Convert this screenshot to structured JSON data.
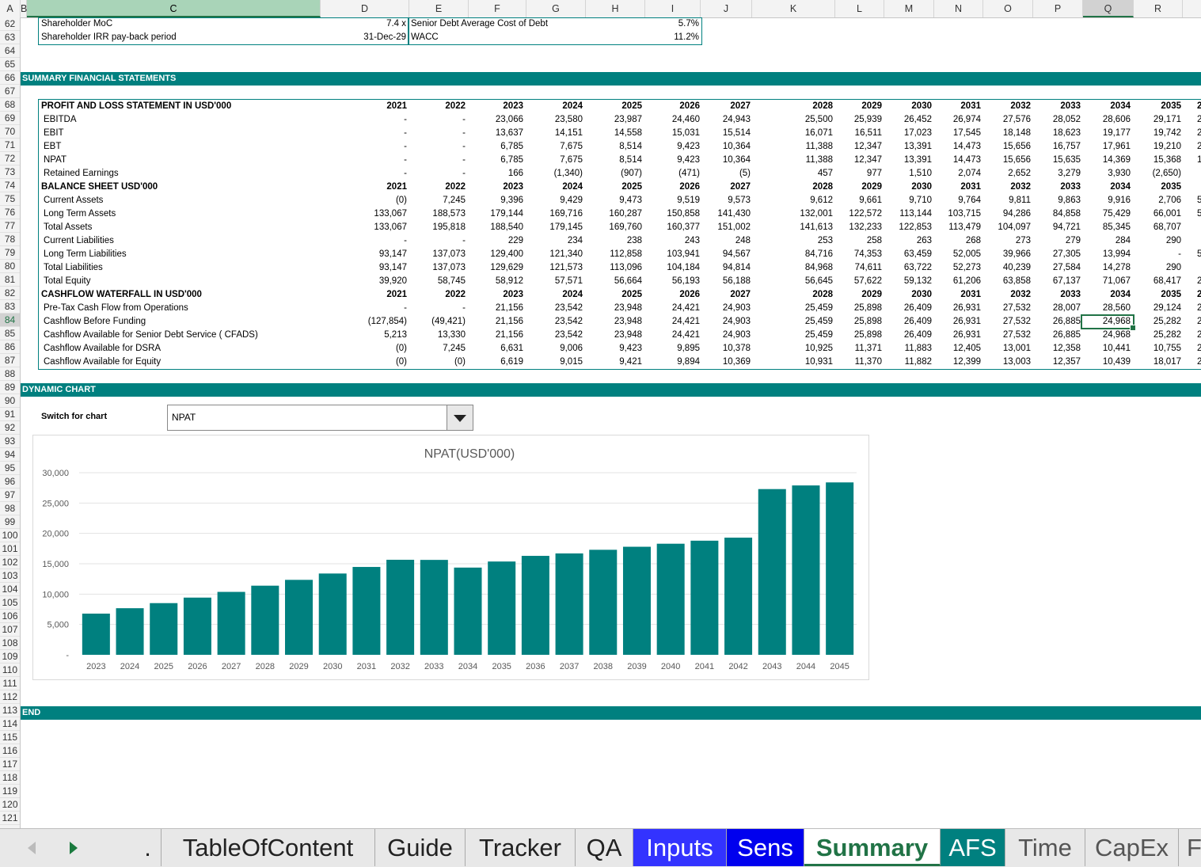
{
  "columns": [
    "A",
    "B",
    "C",
    "D",
    "E",
    "F",
    "G",
    "H",
    "I",
    "J",
    "K",
    "L",
    "M",
    "N",
    "O",
    "P",
    "Q",
    "R"
  ],
  "rows": [
    "62",
    "63",
    "64",
    "65",
    "66",
    "67",
    "68",
    "69",
    "70",
    "71",
    "72",
    "73",
    "74",
    "75",
    "76",
    "77",
    "78",
    "79",
    "80",
    "81",
    "82",
    "83",
    "84",
    "85",
    "86",
    "87",
    "88",
    "89",
    "90",
    "91",
    "92",
    "93",
    "94",
    "95",
    "96",
    "97",
    "98",
    "99",
    "100",
    "101",
    "102",
    "103",
    "104",
    "105",
    "106",
    "107",
    "108",
    "109",
    "110",
    "111",
    "112",
    "113",
    "114",
    "115",
    "116",
    "117",
    "118",
    "119",
    "120",
    "121"
  ],
  "top_metrics": {
    "moc_label": "Shareholder MoC",
    "moc_value": "7.4 x",
    "irr_label": "Shareholder IRR pay-back period",
    "irr_value": "31-Dec-29",
    "debt_label": "Senior Debt  Average Cost of Debt",
    "debt_value": "5.7%",
    "wacc_label": "WACC",
    "wacc_value": "11.2%"
  },
  "banners": {
    "summary": "SUMMARY FINANCIAL STATEMENTS",
    "dynamic": "DYNAMIC CHART",
    "end": "END"
  },
  "table": {
    "years": [
      "2021",
      "2022",
      "2023",
      "2024",
      "2025",
      "2026",
      "2027",
      "2028",
      "2029",
      "2030",
      "2031",
      "2032",
      "2033",
      "2034",
      "2035"
    ],
    "rows": [
      {
        "label": "PROFIT AND LOSS STATEMENT IN USD'000",
        "header": true
      },
      {
        "label": "EBITDA",
        "values": [
          "-",
          "-",
          "23,066",
          "23,580",
          "23,987",
          "24,460",
          "24,943",
          "25,500",
          "25,939",
          "26,452",
          "26,974",
          "27,576",
          "28,052",
          "28,606",
          "29,171"
        ]
      },
      {
        "label": "EBIT",
        "values": [
          "-",
          "-",
          "13,637",
          "14,151",
          "14,558",
          "15,031",
          "15,514",
          "16,071",
          "16,511",
          "17,023",
          "17,545",
          "18,148",
          "18,623",
          "19,177",
          "19,742"
        ]
      },
      {
        "label": "EBT",
        "values": [
          "-",
          "-",
          "6,785",
          "7,675",
          "8,514",
          "9,423",
          "10,364",
          "11,388",
          "12,347",
          "13,391",
          "14,473",
          "15,656",
          "16,757",
          "17,961",
          "19,210"
        ]
      },
      {
        "label": "NPAT",
        "values": [
          "-",
          "-",
          "6,785",
          "7,675",
          "8,514",
          "9,423",
          "10,364",
          "11,388",
          "12,347",
          "13,391",
          "14,473",
          "15,656",
          "15,635",
          "14,369",
          "15,368"
        ]
      },
      {
        "label": "Retained Earnings",
        "values": [
          "-",
          "-",
          "166",
          "(1,340)",
          "(907)",
          "(471)",
          "(5)",
          "457",
          "977",
          "1,510",
          "2,074",
          "2,652",
          "3,279",
          "3,930",
          "(2,650)"
        ]
      },
      {
        "label": "BALANCE SHEET USD'000",
        "header": true
      },
      {
        "label": "Current Assets",
        "values": [
          "(0)",
          "7,245",
          "9,396",
          "9,429",
          "9,473",
          "9,519",
          "9,573",
          "9,612",
          "9,661",
          "9,710",
          "9,764",
          "9,811",
          "9,863",
          "9,916",
          "2,706"
        ]
      },
      {
        "label": "Long Term Assets",
        "values": [
          "133,067",
          "188,573",
          "179,144",
          "169,716",
          "160,287",
          "150,858",
          "141,430",
          "132,001",
          "122,572",
          "113,144",
          "103,715",
          "94,286",
          "84,858",
          "75,429",
          "66,001"
        ]
      },
      {
        "label": "Total Assets",
        "values": [
          "133,067",
          "195,818",
          "188,540",
          "179,145",
          "169,760",
          "160,377",
          "151,002",
          "141,613",
          "132,233",
          "122,853",
          "113,479",
          "104,097",
          "94,721",
          "85,345",
          "68,707"
        ]
      },
      {
        "label": "Current Liabilities",
        "values": [
          "-",
          "-",
          "229",
          "234",
          "238",
          "243",
          "248",
          "253",
          "258",
          "263",
          "268",
          "273",
          "279",
          "284",
          "290"
        ]
      },
      {
        "label": "Long Term Liabilities",
        "values": [
          "93,147",
          "137,073",
          "129,400",
          "121,340",
          "112,858",
          "103,941",
          "94,567",
          "84,716",
          "74,353",
          "63,459",
          "52,005",
          "39,966",
          "27,305",
          "13,994",
          "-"
        ]
      },
      {
        "label": "Total Liabilities",
        "values": [
          "93,147",
          "137,073",
          "129,629",
          "121,573",
          "113,096",
          "104,184",
          "94,814",
          "84,968",
          "74,611",
          "63,722",
          "52,273",
          "40,239",
          "27,584",
          "14,278",
          "290"
        ]
      },
      {
        "label": "Total Equity",
        "values": [
          "39,920",
          "58,745",
          "58,912",
          "57,571",
          "56,664",
          "56,193",
          "56,188",
          "56,645",
          "57,622",
          "59,132",
          "61,206",
          "63,858",
          "67,137",
          "71,067",
          "68,417"
        ]
      },
      {
        "label": "CASHFLOW WATERFALL IN USD'000",
        "header": true
      },
      {
        "label": "Pre-Tax Cash Flow from Operations",
        "values": [
          "-",
          "-",
          "21,156",
          "23,542",
          "23,948",
          "24,421",
          "24,903",
          "25,459",
          "25,898",
          "26,409",
          "26,931",
          "27,532",
          "28,007",
          "28,560",
          "29,124"
        ]
      },
      {
        "label": "Cashflow Before Funding",
        "values": [
          "(127,854)",
          "(49,421)",
          "21,156",
          "23,542",
          "23,948",
          "24,421",
          "24,903",
          "25,459",
          "25,898",
          "26,409",
          "26,931",
          "27,532",
          "26,885",
          "24,968",
          "25,282"
        ]
      },
      {
        "label": "Cashflow Available for Senior Debt Service ( CFADS)",
        "values": [
          "5,213",
          "13,330",
          "21,156",
          "23,542",
          "23,948",
          "24,421",
          "24,903",
          "25,459",
          "25,898",
          "26,409",
          "26,931",
          "27,532",
          "26,885",
          "24,968",
          "25,282"
        ]
      },
      {
        "label": "Cashflow Available for DSRA",
        "values": [
          "(0)",
          "7,245",
          "6,631",
          "9,006",
          "9,423",
          "9,895",
          "10,378",
          "10,925",
          "11,371",
          "11,883",
          "12,405",
          "13,001",
          "12,358",
          "10,441",
          "10,755"
        ]
      },
      {
        "label": "Cashflow Available for Equity",
        "values": [
          "(0)",
          "(0)",
          "6,619",
          "9,015",
          "9,421",
          "9,894",
          "10,369",
          "10,931",
          "11,370",
          "11,882",
          "12,399",
          "13,003",
          "12,357",
          "10,439",
          "18,017"
        ]
      }
    ],
    "overflow": [
      "2",
      "2",
      "2",
      "2",
      "1",
      "",
      "",
      "5",
      "5",
      "",
      "",
      "5",
      "",
      "2",
      "2",
      "2",
      "2",
      "2",
      "2",
      "2"
    ]
  },
  "switch": {
    "label": "Switch for chart",
    "value": "NPAT"
  },
  "chart_data": {
    "type": "bar",
    "title": "NPAT(USD'000)",
    "categories": [
      "2023",
      "2024",
      "2025",
      "2026",
      "2027",
      "2028",
      "2029",
      "2030",
      "2031",
      "2032",
      "2033",
      "2034",
      "2035",
      "2036",
      "2037",
      "2038",
      "2039",
      "2040",
      "2041",
      "2042",
      "2043",
      "2044",
      "2045"
    ],
    "values": [
      6785,
      7675,
      8514,
      9423,
      10364,
      11388,
      12347,
      13391,
      14473,
      15656,
      15635,
      14369,
      15368,
      16300,
      16700,
      17300,
      17800,
      18300,
      18800,
      19300,
      27300,
      27900,
      28400
    ],
    "ylim": [
      0,
      30000
    ],
    "yticks": [
      "-",
      "5,000",
      "10,000",
      "15,000",
      "20,000",
      "25,000",
      "30,000"
    ],
    "color": "#00807f",
    "grid": true
  },
  "tabs": [
    {
      "label": ".",
      "color": "#e8e8e8",
      "text": "#222"
    },
    {
      "label": "TableOfContent",
      "color": "#e8e8e8",
      "text": "#222"
    },
    {
      "label": "Guide",
      "color": "#e8e8e8",
      "text": "#222"
    },
    {
      "label": "Tracker",
      "color": "#e8e8e8",
      "text": "#222"
    },
    {
      "label": "QA",
      "color": "#e8e8e8",
      "text": "#222"
    },
    {
      "label": "Inputs",
      "color": "#3333ff",
      "text": "#ffffff"
    },
    {
      "label": "Sens",
      "color": "#0000ee",
      "text": "#ffffff"
    },
    {
      "label": "Summary",
      "color": "#ffffff",
      "text": "#217346"
    },
    {
      "label": "AFS",
      "color": "#00807f",
      "text": "#ffffff"
    },
    {
      "label": "Time",
      "color": "#e8e8e8",
      "text": "#555"
    },
    {
      "label": "CapEx",
      "color": "#e8e8e8",
      "text": "#555"
    },
    {
      "label": "F",
      "color": "#e8e8e8",
      "text": "#555"
    }
  ]
}
